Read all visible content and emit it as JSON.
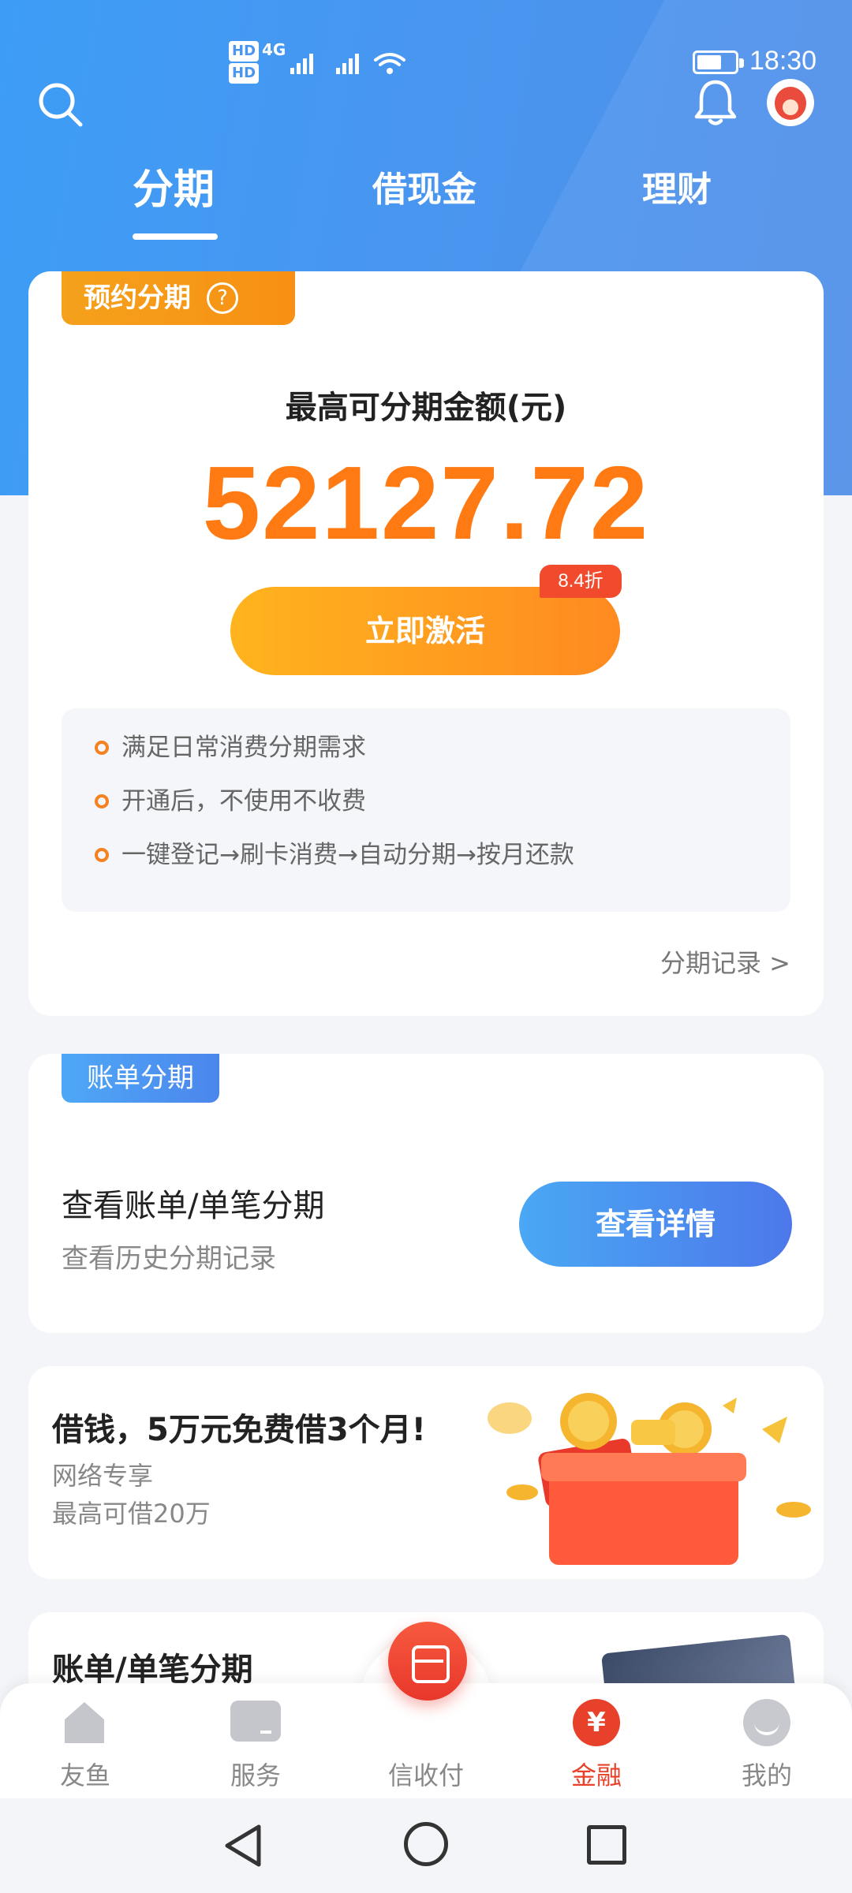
{
  "status_bar": {
    "time": "18:30",
    "hd1": "HD",
    "hd2": "HD",
    "net": "4G"
  },
  "top_tabs": [
    {
      "label": "分期",
      "active": true
    },
    {
      "label": "借现金",
      "active": false
    },
    {
      "label": "理财",
      "active": false
    }
  ],
  "installment_card": {
    "badge": "预约分期",
    "help_symbol": "?",
    "limit_label": "最高可分期金额(元)",
    "limit_amount": "52127.72",
    "activate_button": "立即激活",
    "discount_tag": "8.4折",
    "features": [
      "满足日常消费分期需求",
      "开通后，不使用不收费",
      "一键登记→刷卡消费→自动分期→按月还款"
    ],
    "record_link": "分期记录 >"
  },
  "bill_card": {
    "badge": "账单分期",
    "title": "查看账单/单笔分期",
    "subtitle": "查看历史分期记录",
    "button": "查看详情"
  },
  "loan_card": {
    "title": "借钱，5万元免费借3个月!",
    "line1": "网络专享",
    "line2": "最高可借20万"
  },
  "partial_card": {
    "title": "账单/单笔分期"
  },
  "bottom_nav": [
    {
      "label": "友鱼",
      "icon": "home-icon"
    },
    {
      "label": "服务",
      "icon": "service-icon"
    },
    {
      "label": "信收付",
      "icon": "pay-icon"
    },
    {
      "label": "金融",
      "icon": "finance-icon",
      "active": true,
      "glyph": "¥"
    },
    {
      "label": "我的",
      "icon": "profile-icon"
    }
  ],
  "colors": {
    "brand_blue": "#4a95ef",
    "amount_orange": "#ff7a12",
    "active_red": "#e8412b"
  }
}
